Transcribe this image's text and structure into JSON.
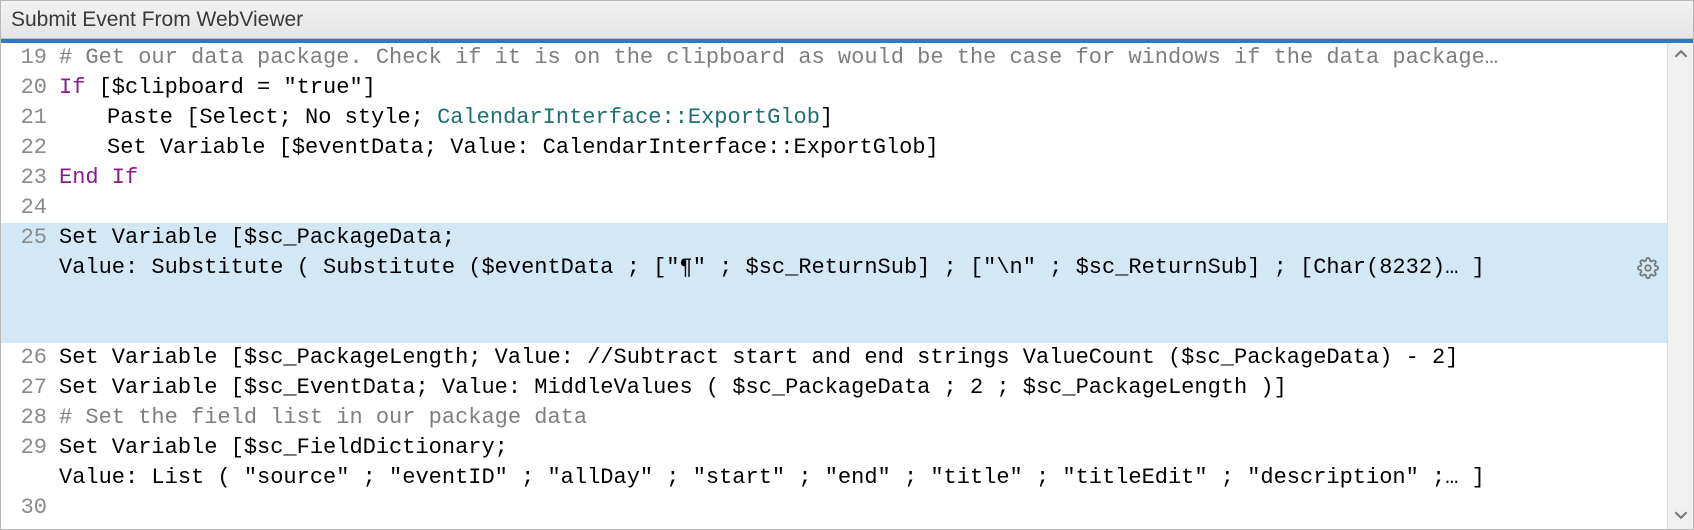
{
  "window": {
    "title": "Submit Event From WebViewer"
  },
  "lines": {
    "l19": {
      "num": "19",
      "comment": "# Get our data package. Check if it is on the clipboard as would be the case for windows if the data package…"
    },
    "l20": {
      "num": "20",
      "kw": "If",
      "rest": " [$clipboard = \"true\"]"
    },
    "l21": {
      "num": "21",
      "a": "Paste [Select; No style; ",
      "fld": "CalendarInterface::ExportGlob",
      "b": "]"
    },
    "l22": {
      "num": "22",
      "text": "Set Variable [$eventData; Value: CalendarInterface::ExportGlob]"
    },
    "l23": {
      "num": "23",
      "kw": "End If"
    },
    "l24": {
      "num": "24"
    },
    "l25a": {
      "num": "25",
      "text": "Set Variable [$sc_PackageData;"
    },
    "l25b": {
      "text": "Value: Substitute ( Substitute ($eventData ; [\"¶\" ; $sc_ReturnSub] ; [\"\\n\" ; $sc_ReturnSub] ; [Char(8232)… ]"
    },
    "l26": {
      "num": "26",
      "text": "Set Variable [$sc_PackageLength; Value: //Subtract start and end strings ValueCount ($sc_PackageData) - 2]"
    },
    "l27": {
      "num": "27",
      "text": "Set Variable [$sc_EventData; Value: MiddleValues ( $sc_PackageData ; 2 ; $sc_PackageLength )]"
    },
    "l28": {
      "num": "28",
      "comment": "# Set the field list in our package data"
    },
    "l29a": {
      "num": "29",
      "text": "Set Variable [$sc_FieldDictionary;"
    },
    "l29b": {
      "text": "Value: List ( \"source\" ; \"eventID\" ; \"allDay\" ; \"start\" ; \"end\" ; \"title\" ; \"titleEdit\" ; \"description\" ;… ]"
    },
    "l30": {
      "num": "30"
    }
  }
}
